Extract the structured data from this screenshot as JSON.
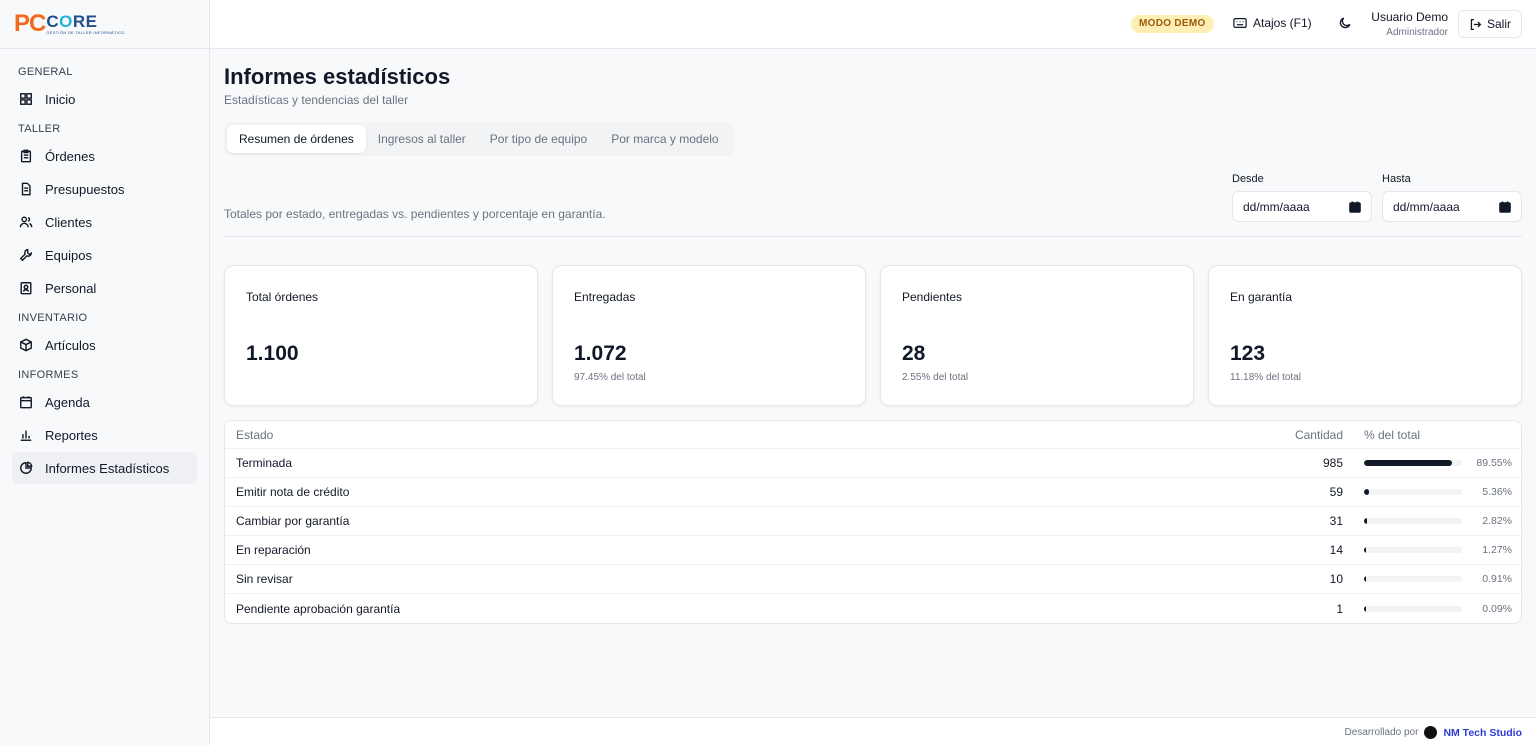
{
  "logo": {
    "pc": "PC",
    "core_c": "C",
    "core_o": "O",
    "core_re": "RE",
    "sub": "GESTIÓN DE TALLER INFORMÁTICO"
  },
  "sidebar": {
    "sections": [
      {
        "title": "GENERAL",
        "items": [
          {
            "label": "Inicio",
            "icon": "grid-icon"
          }
        ]
      },
      {
        "title": "TALLER",
        "items": [
          {
            "label": "Órdenes",
            "icon": "clipboard-icon"
          },
          {
            "label": "Presupuestos",
            "icon": "document-icon"
          },
          {
            "label": "Clientes",
            "icon": "users-icon"
          },
          {
            "label": "Equipos",
            "icon": "wrench-icon"
          },
          {
            "label": "Personal",
            "icon": "id-badge-icon"
          }
        ]
      },
      {
        "title": "INVENTARIO",
        "items": [
          {
            "label": "Artículos",
            "icon": "box-icon"
          }
        ]
      },
      {
        "title": "INFORMES",
        "items": [
          {
            "label": "Agenda",
            "icon": "calendar-icon"
          },
          {
            "label": "Reportes",
            "icon": "bar-chart-icon"
          },
          {
            "label": "Informes Estadísticos",
            "icon": "pie-chart-icon",
            "active": true
          }
        ]
      }
    ]
  },
  "topbar": {
    "demo_badge": "MODO DEMO",
    "shortcuts_label": "Atajos (F1)",
    "user_name": "Usuario Demo",
    "user_role": "Administrador",
    "logout_label": "Salir"
  },
  "page": {
    "title": "Informes estadísticos",
    "subtitle": "Estadísticas y tendencias del taller",
    "tabs": [
      "Resumen de órdenes",
      "Ingresos al taller",
      "Por tipo de equipo",
      "Por marca y modelo"
    ],
    "active_tab": 0,
    "description": "Totales por estado, entregadas vs. pendientes y porcentaje en garantía.",
    "date_from": {
      "label": "Desde",
      "value": "dd/mm/aaaa"
    },
    "date_to": {
      "label": "Hasta",
      "value": "dd/mm/aaaa"
    }
  },
  "cards": [
    {
      "label": "Total órdenes",
      "value": "1.100",
      "sub": ""
    },
    {
      "label": "Entregadas",
      "value": "1.072",
      "sub": "97.45% del total"
    },
    {
      "label": "Pendientes",
      "value": "28",
      "sub": "2.55% del total"
    },
    {
      "label": "En garantía",
      "value": "123",
      "sub": "11.18% del total"
    }
  ],
  "table": {
    "headers": {
      "estado": "Estado",
      "cantidad": "Cantidad",
      "pct": "% del total"
    },
    "rows": [
      {
        "estado": "Terminada",
        "cantidad": "985",
        "pct": "89.55%",
        "fraction": 0.8955
      },
      {
        "estado": "Emitir nota de crédito",
        "cantidad": "59",
        "pct": "5.36%",
        "fraction": 0.0536
      },
      {
        "estado": "Cambiar por garantía",
        "cantidad": "31",
        "pct": "2.82%",
        "fraction": 0.0282
      },
      {
        "estado": "En reparación",
        "cantidad": "14",
        "pct": "1.27%",
        "fraction": 0.0127
      },
      {
        "estado": "Sin revisar",
        "cantidad": "10",
        "pct": "0.91%",
        "fraction": 0.0091
      },
      {
        "estado": "Pendiente aprobación garantía",
        "cantidad": "1",
        "pct": "0.09%",
        "fraction": 0.0009
      }
    ]
  },
  "footer": {
    "developed_by": "Desarrollado por",
    "brand": "NM Tech Studio"
  }
}
